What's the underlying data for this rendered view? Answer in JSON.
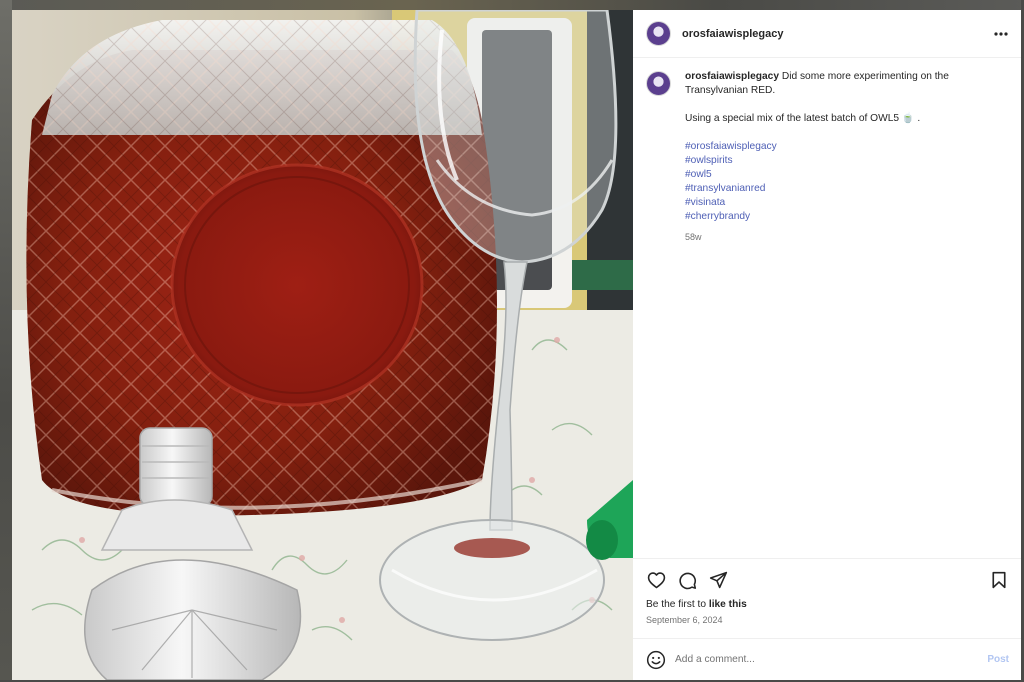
{
  "post": {
    "username": "orosfaiawisplegacy",
    "caption": {
      "line1": "Did some more experimenting on the",
      "line2": "Transylvanian RED.",
      "line3": "Using a special mix of the latest batch of OWL5 🍵 .",
      "hashtags": [
        "#orosfaiawisplegacy",
        "#owlspirits",
        "#owl5",
        "#transylvanianred",
        "#visinata",
        "#cherrybrandy"
      ]
    },
    "age": "58w",
    "likes": {
      "prefix": "Be the first to ",
      "link": "like this"
    },
    "date": "September 6, 2024"
  },
  "comment_box": {
    "placeholder": "Add a comment...",
    "post_label": "Post"
  },
  "icons": {
    "more": "more-horizontal-icon",
    "like": "heart-icon",
    "comment": "comment-bubble-icon",
    "share": "paper-plane-icon",
    "save": "bookmark-icon",
    "emoji": "smiley-icon"
  },
  "colors": {
    "link": "#4e5fb5",
    "muted": "#737373",
    "post_button_disabled": "#b2c6f2",
    "liquid": "#8e1f12"
  }
}
